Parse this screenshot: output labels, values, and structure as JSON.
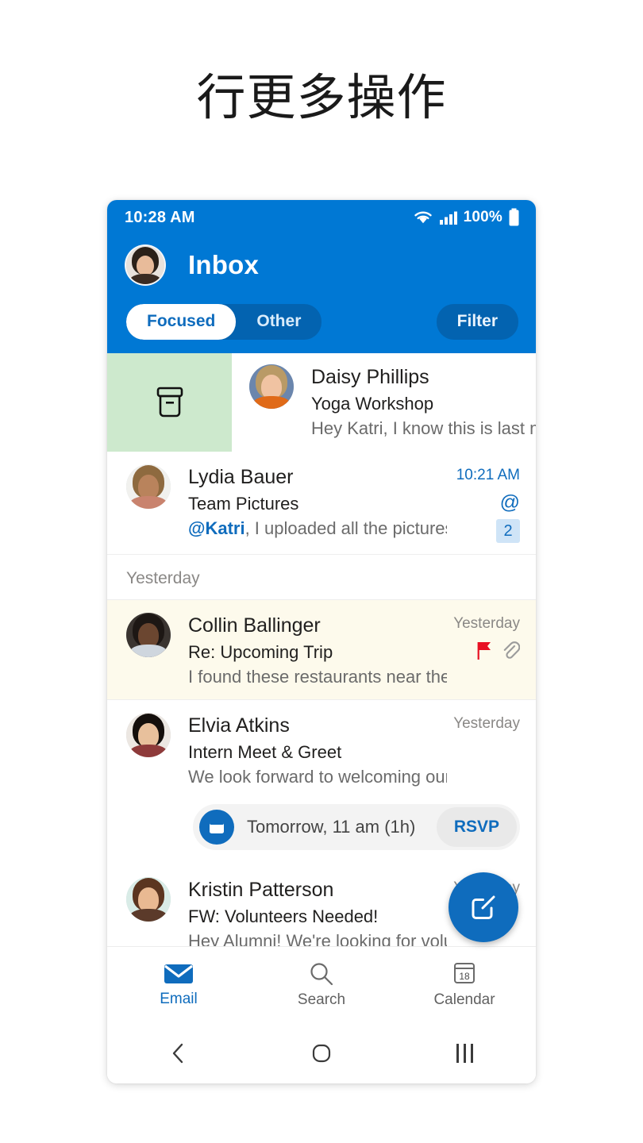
{
  "headline": "行更多操作",
  "colors": {
    "brand_blue": "#0078d4",
    "accent_blue": "#0f6cbd",
    "tab_inactive_blue": "#0363b0",
    "archive_green": "#cde9cd",
    "flag_red": "#e81123",
    "flagged_row_bg": "#fdfaec",
    "badge_bg": "#cfe4f7"
  },
  "status_bar": {
    "time": "10:28 AM",
    "battery_percent": "100%",
    "icons": [
      "wifi-icon",
      "cellular-signal-icon",
      "battery-icon"
    ]
  },
  "header": {
    "title": "Inbox",
    "avatar_name": "account-avatar"
  },
  "tabs": {
    "items": [
      {
        "label": "Focused",
        "active": true
      },
      {
        "label": "Other",
        "active": false
      }
    ],
    "filter_label": "Filter"
  },
  "swipe_row": {
    "action": "archive-icon",
    "mail": {
      "sender": "Daisy Phillips",
      "subject": "Yoga Workshop",
      "preview": "Hey Katri, I know this is last m"
    }
  },
  "sections": [
    {
      "header": null,
      "messages": [
        {
          "sender": "Lydia Bauer",
          "subject": "Team Pictures",
          "preview_mention": "@Katri",
          "preview": ", I uploaded all the pictures fro...",
          "time": "10:21 AM",
          "time_unread": true,
          "mention_icon": true,
          "count_badge": "2",
          "flagged": false,
          "attachment": false
        }
      ]
    },
    {
      "header": "Yesterday",
      "messages": [
        {
          "sender": "Collin Ballinger",
          "subject": "Re: Upcoming Trip",
          "preview": "I found these restaurants near the city ce...",
          "time": "Yesterday",
          "time_unread": false,
          "flagged": true,
          "attachment": true,
          "mention_icon": false,
          "count_badge": null
        },
        {
          "sender": "Elvia Atkins",
          "subject": "Intern Meet & Greet",
          "preview": "We look forward to welcoming our fall int...",
          "time": "Yesterday",
          "time_unread": false,
          "flagged": false,
          "attachment": false,
          "mention_icon": false,
          "count_badge": null,
          "rsvp": {
            "icon": "calendar-icon",
            "text": "Tomorrow, 11 am (1h)",
            "button_label": "RSVP"
          }
        },
        {
          "sender": "Kristin Patterson",
          "subject": "FW: Volunteers Needed!",
          "preview": "Hey Alumni! We're looking for volunte...",
          "time": "Yesterday",
          "time_unread": false,
          "flagged": false,
          "attachment": false,
          "mention_icon": false,
          "count_badge": null
        }
      ]
    }
  ],
  "fab": {
    "icon": "compose-icon"
  },
  "bottom_nav": {
    "items": [
      {
        "label": "Email",
        "icon": "mail-icon",
        "active": true
      },
      {
        "label": "Search",
        "icon": "search-icon",
        "active": false
      },
      {
        "label": "Calendar",
        "icon": "calendar-icon",
        "active": false,
        "day": "18"
      }
    ]
  },
  "android_nav": {
    "back": "back-chevron-icon",
    "home": "home-circle-icon",
    "recents": "recents-icon"
  }
}
